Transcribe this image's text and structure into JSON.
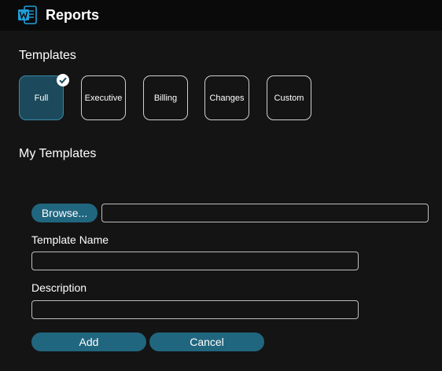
{
  "app": {
    "title": "Reports",
    "icon": "word-icon",
    "icon_color": "#1f9fd8",
    "accent": "#21667f"
  },
  "templates": {
    "heading": "Templates",
    "items": [
      {
        "label": "Full",
        "selected": true
      },
      {
        "label": "Executive",
        "selected": false
      },
      {
        "label": "Billing",
        "selected": false
      },
      {
        "label": "Changes",
        "selected": false
      },
      {
        "label": "Custom",
        "selected": false
      }
    ]
  },
  "my_templates": {
    "heading": "My Templates",
    "browse_label": "Browse...",
    "file_path_value": "",
    "template_name_label": "Template Name",
    "template_name_value": "",
    "description_label": "Description",
    "description_value": "",
    "add_label": "Add",
    "cancel_label": "Cancel"
  }
}
